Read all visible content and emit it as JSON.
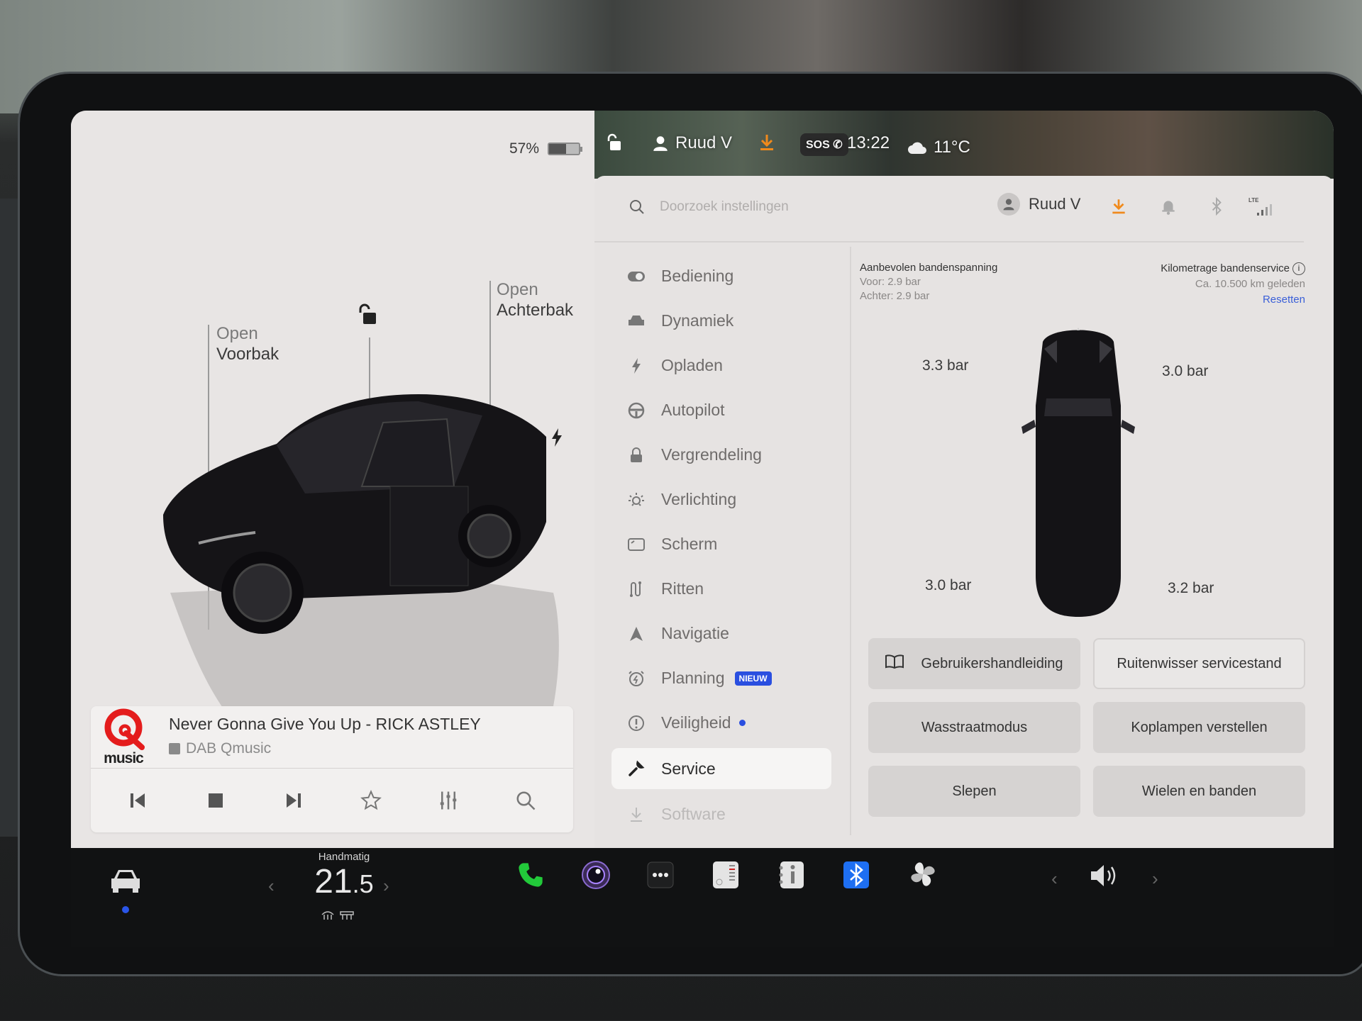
{
  "car_panel": {
    "battery_percent_label": "57%",
    "battery_level": 0.57,
    "frunk": {
      "action": "Open",
      "label": "Voorbak"
    },
    "trunk": {
      "action": "Open",
      "label": "Achterbak"
    }
  },
  "media": {
    "station_logo_text": "music",
    "song": "Never Gonna Give You Up - RICK ASTLEY",
    "source": "DAB Qmusic",
    "controls": [
      "previous",
      "stop",
      "next",
      "favorite",
      "equalizer",
      "search"
    ]
  },
  "status_bar": {
    "profile_name": "Ruud V",
    "sos": "SOS",
    "time": "13:22",
    "temperature": "11°C"
  },
  "settings": {
    "search_placeholder": "Doorzoek instellingen",
    "profile_name": "Ruud V",
    "signal_label": "LTE",
    "nav": [
      {
        "label": "Bediening",
        "icon": "toggle-icon"
      },
      {
        "label": "Dynamiek",
        "icon": "car-icon"
      },
      {
        "label": "Opladen",
        "icon": "bolt-icon"
      },
      {
        "label": "Autopilot",
        "icon": "steering-wheel-icon"
      },
      {
        "label": "Vergrendeling",
        "icon": "lock-icon"
      },
      {
        "label": "Verlichting",
        "icon": "light-icon"
      },
      {
        "label": "Scherm",
        "icon": "display-icon"
      },
      {
        "label": "Ritten",
        "icon": "trips-icon"
      },
      {
        "label": "Navigatie",
        "icon": "navigation-icon"
      },
      {
        "label": "Planning",
        "icon": "alarm-clock-icon",
        "badge": "NIEUW"
      },
      {
        "label": "Veiligheid",
        "icon": "alert-icon",
        "dot": true
      },
      {
        "label": "Service",
        "icon": "wrench-icon",
        "active": true
      },
      {
        "label": "Software",
        "icon": "download-icon"
      }
    ],
    "service": {
      "recommended_title": "Aanbevolen bandenspanning",
      "recommended_front": "Voor: 2.9 bar",
      "recommended_rear": "Achter: 2.9 bar",
      "tire_service_title": "Kilometrage bandenservice",
      "tire_service_value": "Ca. 10.500 km geleden",
      "reset_label": "Resetten",
      "tires": {
        "front_left": "3.3 bar",
        "front_right": "3.0 bar",
        "rear_left": "3.0 bar",
        "rear_right": "3.2 bar"
      },
      "buttons": [
        {
          "label": "Gebruikershandleiding",
          "icon": "book-icon"
        },
        {
          "label": "Ruitenwisser servicestand"
        },
        {
          "label": "Wasstraatmodus"
        },
        {
          "label": "Koplampen verstellen"
        },
        {
          "label": "Slepen"
        },
        {
          "label": "Wielen en banden"
        }
      ]
    }
  },
  "dock": {
    "climate_mode": "Handmatig",
    "temp_int": "21",
    "temp_dec": ".5",
    "colors": {
      "phone": "#22c93a",
      "bluetooth": "#1e6ff2"
    }
  }
}
